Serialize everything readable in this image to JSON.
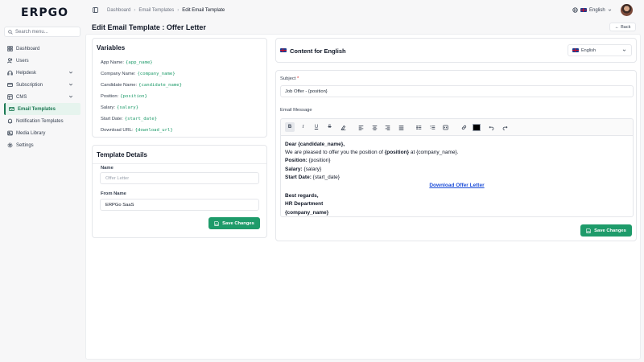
{
  "app": {
    "logo": "ERPGO"
  },
  "search": {
    "placeholder": "Search menu..."
  },
  "sidebar": {
    "items": [
      {
        "label": "Dashboard",
        "icon": "dashboard-icon"
      },
      {
        "label": "Users",
        "icon": "users-icon"
      },
      {
        "label": "Helpdesk",
        "icon": "headset-icon"
      },
      {
        "label": "Subscription",
        "icon": "card-icon"
      },
      {
        "label": "CMS",
        "icon": "cms-icon"
      },
      {
        "label": "Email Templates",
        "icon": "mail-icon"
      },
      {
        "label": "Notification Templates",
        "icon": "bell-icon"
      },
      {
        "label": "Media Library",
        "icon": "image-icon"
      },
      {
        "label": "Settings",
        "icon": "gear-icon"
      }
    ]
  },
  "breadcrumb": {
    "home": "Dashboard",
    "parent": "Email Templates",
    "current": "Edit Email Template"
  },
  "header": {
    "language": "English"
  },
  "page": {
    "title": "Edit Email Template : Offer Letter",
    "back_label": "Back"
  },
  "variables": {
    "title": "Variables",
    "items": [
      {
        "label": "App Name:",
        "code": "{app_name}"
      },
      {
        "label": "Company Name:",
        "code": "{company_name}"
      },
      {
        "label": "Candidate Name:",
        "code": "{candidate_name}"
      },
      {
        "label": "Position:",
        "code": "{position}"
      },
      {
        "label": "Salary:",
        "code": "{salary}"
      },
      {
        "label": "Start Date:",
        "code": "{start_date}"
      },
      {
        "label": "Download URL:",
        "code": "{download_url}"
      }
    ]
  },
  "template_details": {
    "title": "Template Details",
    "name_label": "Name",
    "name_placeholder": "Offer Letter",
    "from_label": "From Name",
    "from_value": "ERPGo SaaS",
    "save_label": "Save Changes"
  },
  "content": {
    "title": "Content for English",
    "language_select": "English",
    "subject_label": "Subject",
    "subject_required": "*",
    "subject_value": "Job Offer - {position}",
    "message_label": "Email Message",
    "body": {
      "greeting": "Dear {candidate_name},",
      "line1_pre": "We are pleased to offer you the position of ",
      "line1_bold": "{position}",
      "line1_post": " at {company_name}.",
      "position_label": "Position:",
      "position_value": " {position}",
      "salary_label": "Salary:",
      "salary_value": " {salary}",
      "start_label": "Start Date:",
      "start_value": " {start_date}",
      "download_link": "Download Offer Letter",
      "regards": "Best regards,",
      "dept": "HR Department",
      "company": "{company_name}"
    },
    "save_label": "Save Changes"
  }
}
